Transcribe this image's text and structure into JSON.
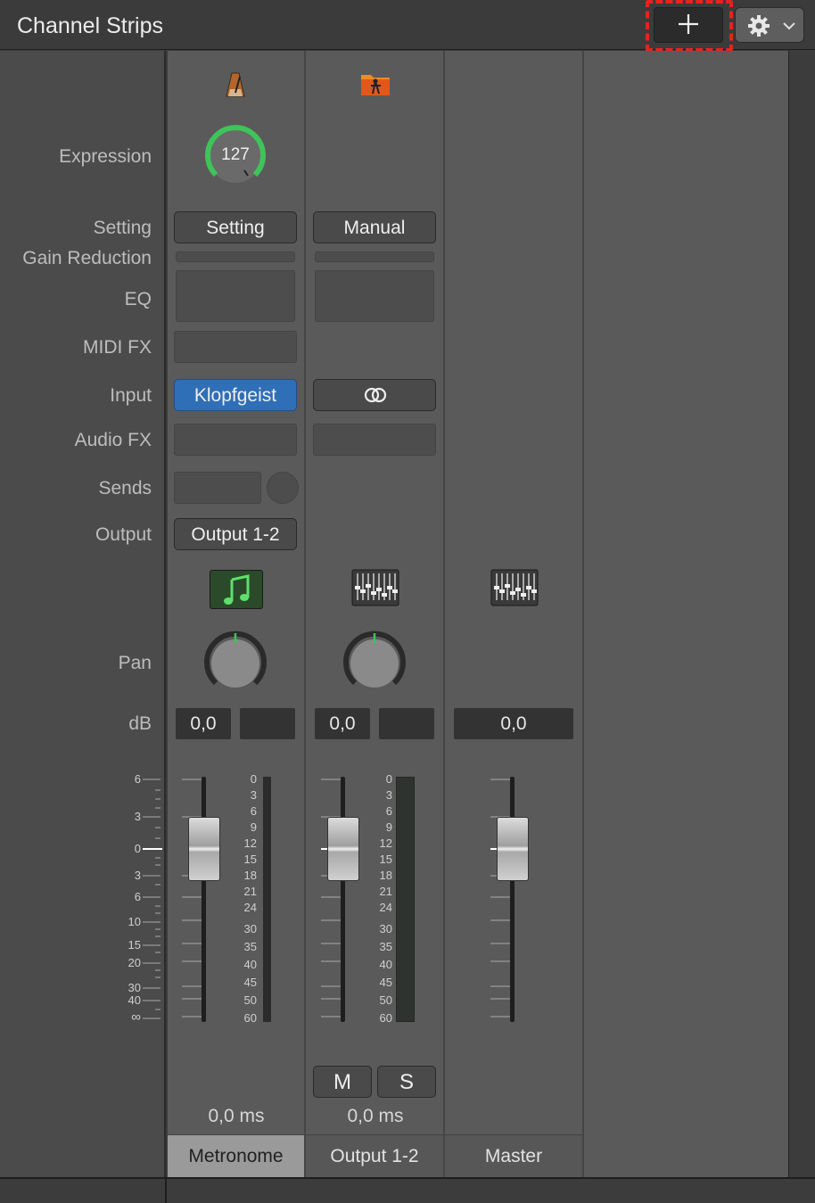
{
  "window": {
    "title": "Channel Strips"
  },
  "toolbar": {
    "add_icon": "plus-icon",
    "gear_icon": "gear-icon",
    "gear_menu_icon": "chevron-down-icon"
  },
  "row_labels": {
    "expression": "Expression",
    "setting": "Setting",
    "gain_reduction": "Gain Reduction",
    "eq": "EQ",
    "midi_fx": "MIDI FX",
    "input": "Input",
    "audio_fx": "Audio FX",
    "sends": "Sends",
    "output": "Output",
    "pan": "Pan",
    "db": "dB"
  },
  "fader_scale": [
    "6",
    "3",
    "0",
    "3",
    "6",
    "10",
    "15",
    "20",
    "30",
    "40",
    "∞"
  ],
  "meter_scale": [
    "0",
    "3",
    "6",
    "9",
    "12",
    "15",
    "18",
    "21",
    "24",
    "30",
    "35",
    "40",
    "45",
    "50",
    "60"
  ],
  "strips": [
    {
      "name": "Metronome",
      "top_icon": "metronome-icon",
      "expression": "127",
      "setting": "Setting",
      "input": "Klopfgeist",
      "output": "Output 1-2",
      "type_icon": "music-note-icon",
      "db": "0,0",
      "latency": "0,0 ms"
    },
    {
      "name": "Output 1-2",
      "top_icon": "folder-icon",
      "setting": "Manual",
      "input_icon": "stereo-link-icon",
      "type_icon": "mixer-icon",
      "db": "0,0",
      "mute": "M",
      "solo": "S",
      "latency": "0,0 ms"
    },
    {
      "name": "Master",
      "type_icon": "mixer-icon",
      "db": "0,0"
    }
  ],
  "colors": {
    "accent_green": "#3ec45a",
    "input_blue": "#2f6fb8",
    "highlight_red": "#e8231a"
  }
}
